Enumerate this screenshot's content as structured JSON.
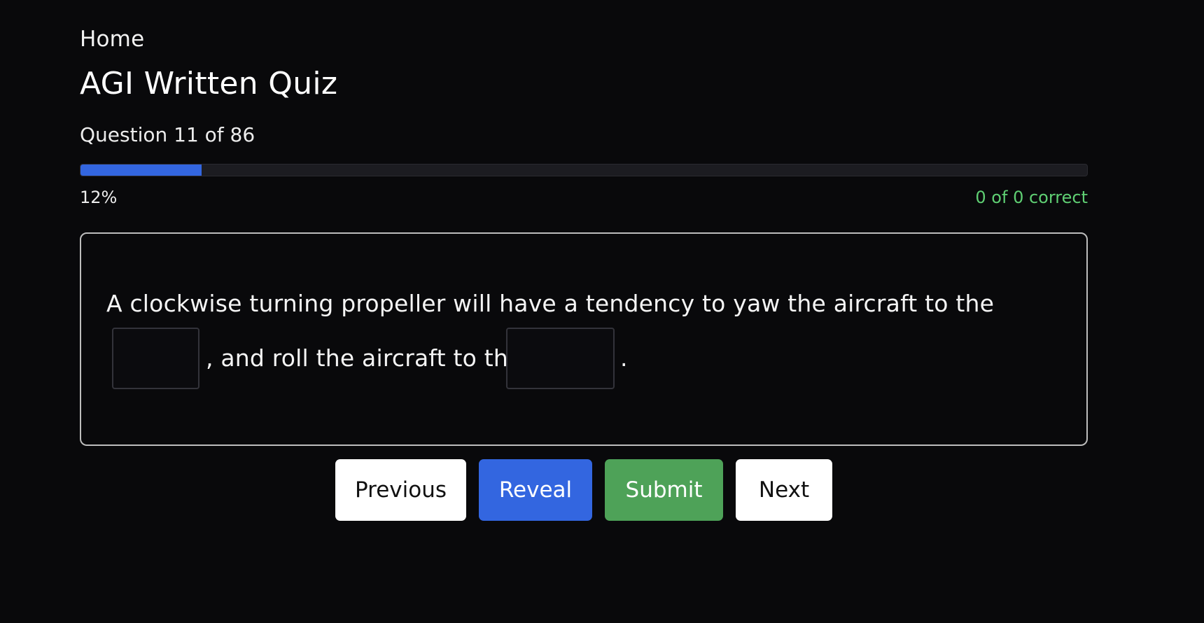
{
  "nav": {
    "home_label": "Home"
  },
  "header": {
    "title": "AGI Written Quiz"
  },
  "progress": {
    "question_label": "Question 11 of 86",
    "current_question": 11,
    "total_questions": 86,
    "percent_label": "12%",
    "percent_value": 12,
    "score_label": "0 of 0 correct"
  },
  "question": {
    "text_part1": "A clockwise turning propeller will have a tendency to yaw the aircraft to the",
    "text_part2": ", and roll the aircraft to the",
    "text_part3": ".",
    "blank1_value": "",
    "blank2_value": ""
  },
  "buttons": {
    "previous": "Previous",
    "reveal": "Reveal",
    "submit": "Submit",
    "next": "Next"
  },
  "colors": {
    "background": "#09090b",
    "progress_fill": "#3366e0",
    "score_text": "#5fcf73",
    "reveal_button": "#3366e0",
    "submit_button": "#4ea258"
  }
}
